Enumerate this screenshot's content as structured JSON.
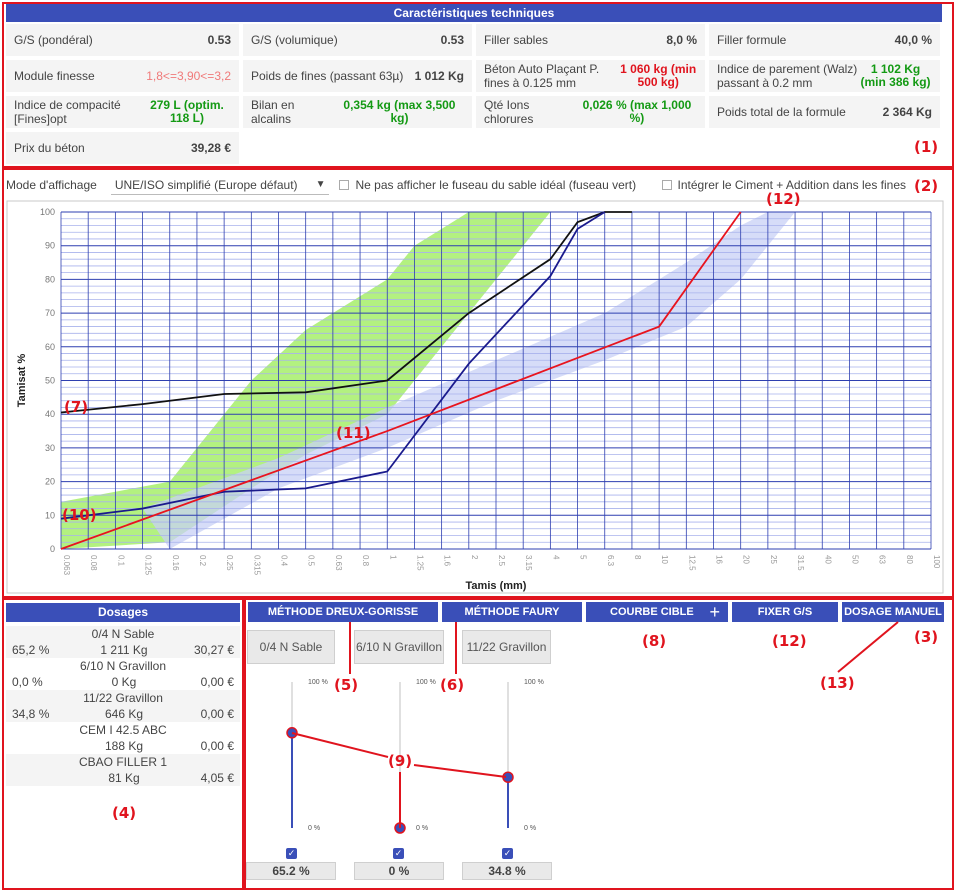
{
  "specs": {
    "title": "Caractéristiques techniques",
    "rows": [
      [
        {
          "label": "G/S (pondéral)",
          "value": "0.53"
        },
        {
          "label": "G/S (volumique)",
          "value": "0.53"
        },
        {
          "label": "Filler sables",
          "value": "8,0 %"
        },
        {
          "label": "Filler formule",
          "value": "40,0 %"
        }
      ],
      [
        {
          "label": "Module finesse",
          "value": "1,8<=3,90<=3,2",
          "style": "salmon"
        },
        {
          "label": "Poids de fines (passant 63µ)",
          "value": "1 012 Kg"
        },
        {
          "label": "Béton Auto Plaçant P. fines à 0.125 mm",
          "value": "1 060 kg (min 500 kg)",
          "style": "red"
        },
        {
          "label": "Indice de parement (Walz) passant à 0.2 mm",
          "value": "1 102 Kg (min 386 kg)",
          "style": "green"
        }
      ],
      [
        {
          "label": "Indice de compacité [Fines]opt",
          "value": "279 L (optim. 118 L)",
          "style": "green"
        },
        {
          "label": "Bilan en alcalins",
          "value": "0,354 kg (max 3,500 kg)",
          "style": "green"
        },
        {
          "label": "Qté Ions chlorures",
          "value": "0,026 % (max 1,000 %)",
          "style": "green"
        },
        {
          "label": "Poids total de la formule",
          "value": "2 364 Kg"
        }
      ],
      [
        {
          "label": "Prix du béton",
          "value": "39,28 €"
        }
      ]
    ]
  },
  "controls": {
    "mode_label": "Mode d'affichage",
    "mode_value": "UNE/ISO simplifié (Europe défaut)",
    "hide_fuseau_label": "Ne pas afficher le fuseau du sable idéal (fuseau vert)",
    "integrate_label": "Intégrer le Ciment + Addition dans les fines"
  },
  "chart_data": {
    "type": "line",
    "ylabel": "Tamisat %",
    "xlabel": "Tamis (mm)",
    "categories": [
      "0.063",
      "0.08",
      "0.1",
      "0.125",
      "0.16",
      "0.2",
      "0.25",
      "0.315",
      "0.4",
      "0.5",
      "0.63",
      "0.8",
      "1",
      "1.25",
      "1.6",
      "2",
      "2.5",
      "3.15",
      "4",
      "5",
      "6.3",
      "8",
      "10",
      "12.5",
      "16",
      "20",
      "25",
      "31.5",
      "40",
      "50",
      "63",
      "80",
      "100"
    ],
    "yticks": [
      0,
      10,
      20,
      30,
      40,
      50,
      60,
      70,
      80,
      90,
      100
    ],
    "ylim": [
      0,
      100
    ],
    "series": [
      {
        "color": "#111111",
        "points": [
          [
            0,
            40.5
          ],
          [
            3,
            43
          ],
          [
            6,
            46
          ],
          [
            9,
            46.5
          ],
          [
            12,
            50
          ],
          [
            15,
            70
          ],
          [
            18,
            86
          ],
          [
            19,
            97
          ],
          [
            20,
            100
          ],
          [
            21,
            100
          ]
        ]
      },
      {
        "color": "#1a1a8c",
        "points": [
          [
            0,
            9
          ],
          [
            3,
            12
          ],
          [
            6,
            17
          ],
          [
            9,
            18
          ],
          [
            12,
            23
          ],
          [
            15,
            55
          ],
          [
            18,
            81
          ],
          [
            19,
            95
          ],
          [
            20,
            100
          ]
        ]
      },
      {
        "color": "#e8141e",
        "points": [
          [
            0,
            0
          ],
          [
            12,
            35
          ],
          [
            22,
            66
          ],
          [
            25,
            100
          ]
        ]
      }
    ],
    "green_band": {
      "upper": [
        [
          0,
          14
        ],
        [
          4,
          20
        ],
        [
          7,
          50
        ],
        [
          9,
          65
        ],
        [
          12,
          80
        ],
        [
          13,
          90
        ],
        [
          15,
          100
        ],
        [
          18,
          100
        ]
      ],
      "lower": [
        [
          0,
          0
        ],
        [
          4,
          2
        ],
        [
          7,
          18
        ],
        [
          9,
          28
        ],
        [
          12,
          40
        ],
        [
          14,
          60
        ],
        [
          16,
          80
        ],
        [
          18,
          100
        ]
      ]
    },
    "blue_band": {
      "upper": [
        [
          3,
          12
        ],
        [
          8,
          27
        ],
        [
          12,
          42
        ],
        [
          16,
          56
        ],
        [
          20,
          70
        ],
        [
          23,
          85
        ],
        [
          25,
          96
        ],
        [
          26,
          100
        ],
        [
          28,
          100
        ]
      ],
      "lower": [
        [
          4,
          0
        ],
        [
          8,
          18
        ],
        [
          12,
          30
        ],
        [
          16,
          44
        ],
        [
          20,
          56
        ],
        [
          23,
          66
        ],
        [
          25,
          80
        ],
        [
          27,
          100
        ]
      ]
    }
  },
  "dosages": {
    "title": "Dosages",
    "items": [
      {
        "name": "0/4 N Sable",
        "pct": "65,2 %",
        "qty": "1 211 Kg",
        "price": "30,27 €"
      },
      {
        "name": "6/10 N Gravillon",
        "pct": "0,0 %",
        "qty": "0 Kg",
        "price": "0,00 €"
      },
      {
        "name": "11/22 Gravillon",
        "pct": "34,8 %",
        "qty": "646 Kg",
        "price": "0,00 €"
      },
      {
        "name": "CEM I 42.5 ABC",
        "pct": "",
        "qty": "188 Kg",
        "price": "0,00 €"
      },
      {
        "name": "CBAO FILLER 1",
        "pct": "",
        "qty": "81 Kg",
        "price": "4,05 €"
      }
    ]
  },
  "methods": {
    "dreux": "MÉTHODE DREUX-GORISSE",
    "faury": "MÉTHODE FAURY",
    "courbe": "COURBE CIBLE",
    "plus": "+",
    "fixer": "FIXER G/S",
    "manuel": "DOSAGE MANUEL"
  },
  "sliders": [
    {
      "name": "0/4 N Sable",
      "max": "100 %",
      "min": "0 %",
      "value": "65.2 %",
      "fraction": 0.652
    },
    {
      "name": "6/10 N Gravillon",
      "max": "100 %",
      "min": "0 %",
      "value": "0 %",
      "fraction": 0.0
    },
    {
      "name": "11/22 Gravillon",
      "max": "100 %",
      "min": "0 %",
      "value": "34.8 %",
      "fraction": 0.348
    }
  ],
  "callouts": {
    "c1": "(1)",
    "c2": "(2)",
    "c3": "(3)",
    "c4": "(4)",
    "c5": "(5)",
    "c6": "(6)",
    "c7": "(7)",
    "c8": "(8)",
    "c9": "(9)",
    "c10": "(10)",
    "c11": "(11)",
    "c12a": "(12)",
    "c12b": "(12)",
    "c13": "(13)"
  },
  "colors": {
    "accent": "#3a4fb8",
    "annotation": "#e0141e"
  }
}
